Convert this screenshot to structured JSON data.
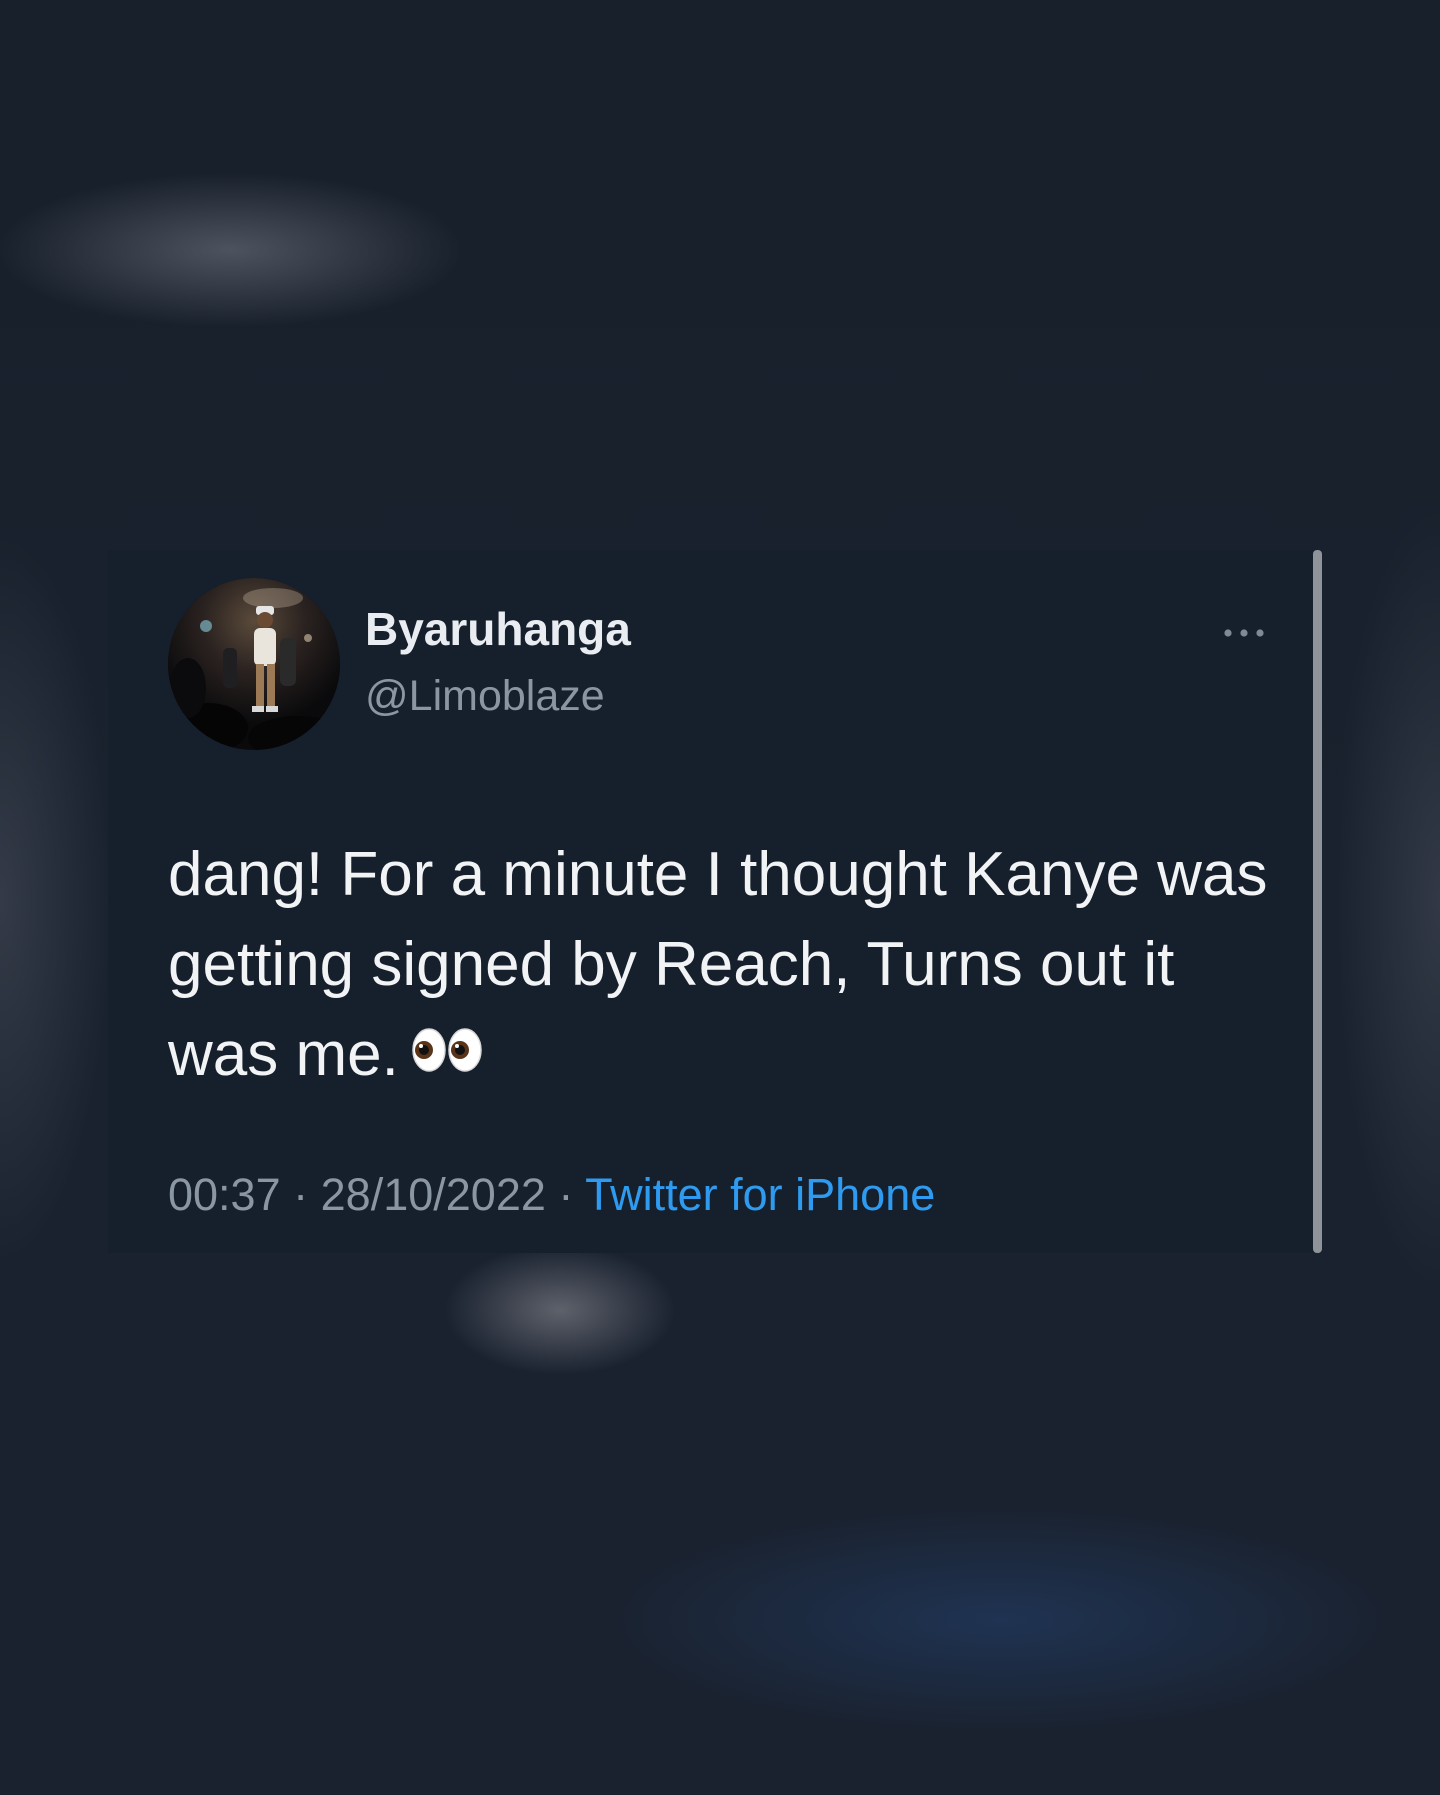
{
  "tweet": {
    "display_name": "Byaruhanga",
    "handle": "@Limoblaze",
    "text": "dang! For a minute I thought Kanye was getting signed by Reach, Turns out it was me.",
    "emoji_icon": "eyes-emoji-icon",
    "time": "00:37",
    "separator": "·",
    "date": "28/10/2022",
    "source": "Twitter for iPhone"
  },
  "colors": {
    "background": "#18212d",
    "card": "#161f2c",
    "primary_text": "#f1f3f5",
    "secondary_text": "#8b96a3",
    "link": "#2e9bf0",
    "scrollbar": "#8f949a"
  }
}
